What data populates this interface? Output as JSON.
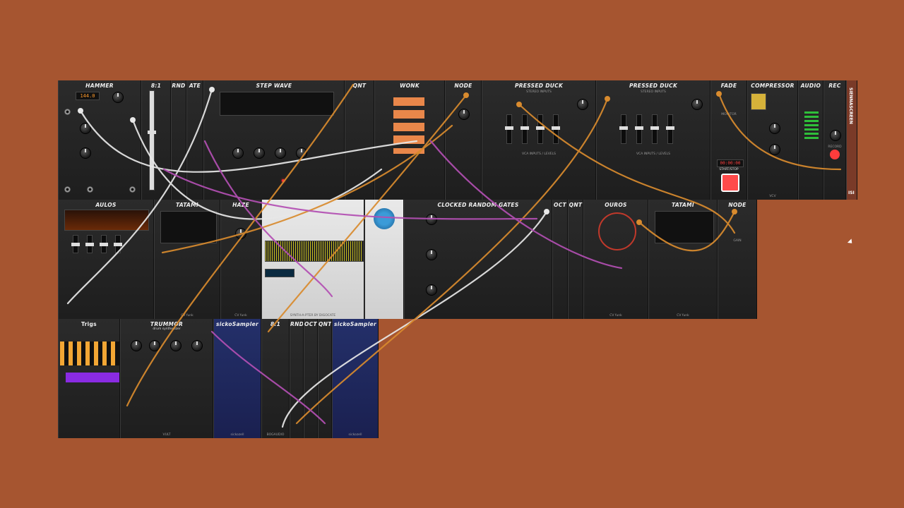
{
  "colors": {
    "background": "#a65530",
    "module_panel": "#222222",
    "cable_orange": "#d98b2e",
    "cable_white": "#e8e8e8",
    "cable_purple": "#b34fb3"
  },
  "rack": {
    "row1": [
      {
        "label": "HAMMER",
        "kind": "dark"
      },
      {
        "label": "8:1",
        "kind": "dark"
      },
      {
        "label": "RND",
        "kind": "dark"
      },
      {
        "label": "ATE",
        "kind": "dark"
      },
      {
        "label": "STEP WAVE",
        "kind": "dark"
      },
      {
        "label": "QNT",
        "kind": "dark"
      },
      {
        "label": "WONK",
        "kind": "dark"
      },
      {
        "label": "NODE",
        "kind": "dark"
      },
      {
        "label": "PRESSED DUCK",
        "kind": "dark"
      },
      {
        "label": "PRESSED DUCK",
        "kind": "dark"
      },
      {
        "label": "FADE",
        "kind": "dark"
      },
      {
        "label": "COMPRESSOR",
        "kind": "dark"
      },
      {
        "label": "AUDIO",
        "kind": "dark"
      },
      {
        "label": "REC",
        "kind": "dark"
      },
      {
        "label": "SIENNASCREEN",
        "kind": "dark"
      }
    ],
    "row2": [
      {
        "label": "AULOS",
        "kind": "dark"
      },
      {
        "label": "TATAMI",
        "kind": "dark"
      },
      {
        "label": "HAZE",
        "kind": "dark"
      },
      {
        "label": "",
        "kind": "light"
      },
      {
        "label": "",
        "kind": "light"
      },
      {
        "label": "CLOCKED RANDOM GATES",
        "kind": "dark"
      },
      {
        "label": "OCT",
        "kind": "dark"
      },
      {
        "label": "QNT",
        "kind": "dark"
      },
      {
        "label": "OUROS",
        "kind": "dark"
      },
      {
        "label": "TATAMI",
        "kind": "dark"
      },
      {
        "label": "NODE",
        "kind": "dark"
      }
    ],
    "row3": [
      {
        "label": "Trigs",
        "kind": "dark"
      },
      {
        "label": "TRUMMOR",
        "kind": "dark"
      },
      {
        "label": "sickoSampler",
        "kind": "navy"
      },
      {
        "label": "8:1",
        "kind": "dark"
      },
      {
        "label": "RND",
        "kind": "dark"
      },
      {
        "label": "OCT",
        "kind": "dark"
      },
      {
        "label": "QNT",
        "kind": "dark"
      },
      {
        "label": "sickoSampler",
        "kind": "navy"
      }
    ]
  },
  "texts": {
    "hammer_display": "144.0",
    "record_time": "00:00:00",
    "start_stop": "START/STOP",
    "record_label": "RECORD",
    "monitor_label": "MONITOR",
    "trummor_sub": "drum synthesizer",
    "vcv": "VCV",
    "bogaudio": "BOGAUDIO",
    "vult": "VULT",
    "sickozell": "sickozell",
    "synth_footer": "SYNTH-A-PTER BY DIGOCATE",
    "stereo_inputs": "STEREO INPUTS",
    "vca_inputs": "VCA INPUTS / LEVELS",
    "gain": "GAIN",
    "cv_funk": "CV funk",
    "siennascreen_badge": "ISI"
  }
}
